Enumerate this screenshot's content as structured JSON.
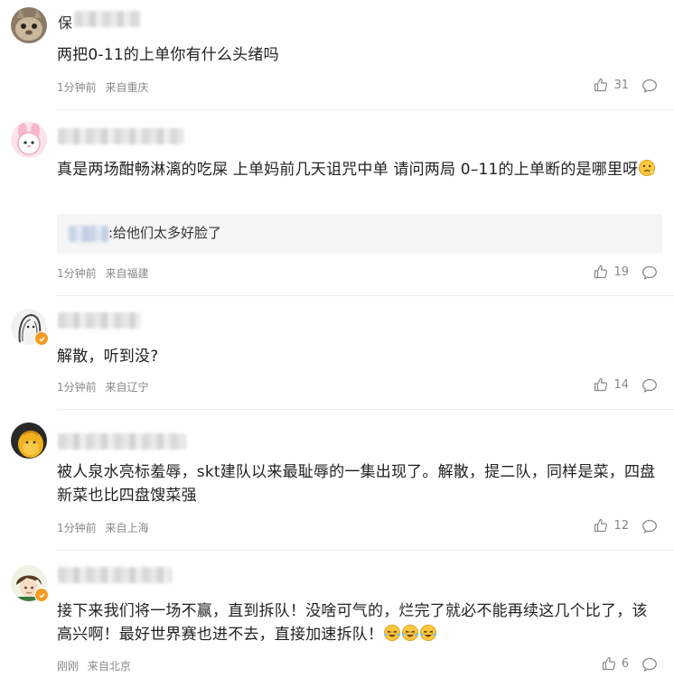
{
  "comments": [
    {
      "name_initial": "保",
      "text": "两把0-11的上单你有什么头绪吗",
      "time": "1分钟前",
      "location": "来自重庆",
      "likes": "31",
      "avatar_icon": "cat-avatar-icon"
    },
    {
      "name_initial": "",
      "text": "真是两场酣畅淋漓的吃屎 上单妈前几天诅咒中单 请问两局 0–11的上单断的是哪里呀",
      "reply": ":给他们太多好脸了",
      "time": "1分钟前",
      "location": "来自福建",
      "likes": "19",
      "avatar_icon": "pink-bunny-avatar-icon"
    },
    {
      "name_initial": "",
      "text": "解散，听到没?",
      "time": "1分钟前",
      "location": "来自辽宁",
      "likes": "14",
      "avatar_icon": "sketch-avatar-icon",
      "verified": true
    },
    {
      "name_initial": "",
      "text": "被人泉水亮标羞辱，skt建队以来最耻辱的一集出现了。解散，提二队，同样是菜，四盘新菜也比四盘馊菜强",
      "time": "1分钟前",
      "location": "来自上海",
      "likes": "12",
      "avatar_icon": "yellow-character-avatar-icon"
    },
    {
      "name_initial": "",
      "text": "接下来我们将一场不赢，直到拆队！没啥可气的，烂完了就必不能再续这几个比了，该高兴啊！最好世界赛也进不去，直接加速拆队！",
      "time": "刚刚",
      "location": "来自北京",
      "likes": "6",
      "avatar_icon": "anime-boy-avatar-icon",
      "verified": true
    }
  ],
  "colors": {
    "meta": "#888888",
    "text": "#222222",
    "reply_bg": "#f5f5f5",
    "verified": "#f39a21",
    "divider": "#eeeeee"
  }
}
